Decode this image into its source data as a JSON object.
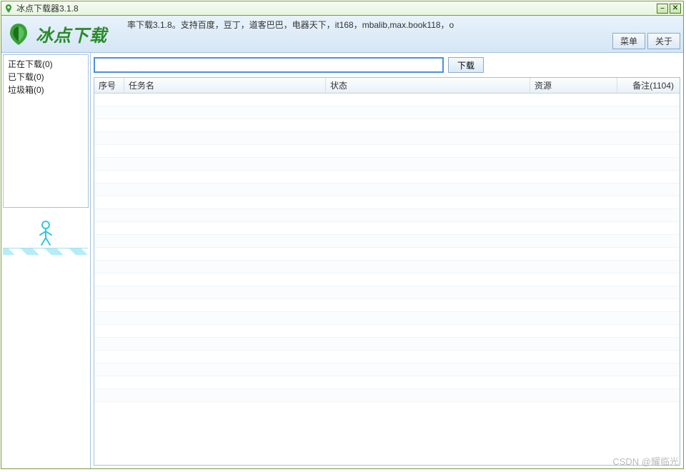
{
  "window": {
    "title": "冰点下载器3.1.8"
  },
  "header": {
    "logo_text": "冰点下载",
    "description": "率下载3.1.8。支持百度，豆丁，道客巴巴，电器天下，it168，mbalib,max.book118，o",
    "menu_label": "菜单",
    "about_label": "关于"
  },
  "sidebar": {
    "items": [
      {
        "label": "正在下载(0)"
      },
      {
        "label": "已下载(0)"
      },
      {
        "label": "垃圾箱(0)"
      }
    ]
  },
  "urlbar": {
    "value": "",
    "download_label": "下载"
  },
  "table": {
    "columns": {
      "seq": "序号",
      "task": "任务名",
      "status": "状态",
      "resource": "资源",
      "note": "备注(1104)"
    },
    "rows": []
  },
  "watermark": "CSDN @耀临光"
}
